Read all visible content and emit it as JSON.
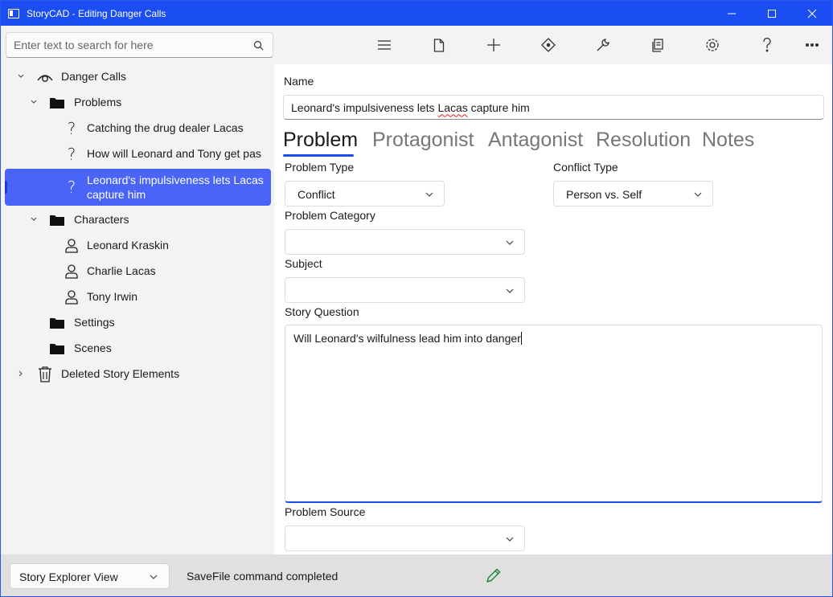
{
  "window": {
    "title": "StoryCAD - Editing Danger Calls",
    "accent": "#1a4ef2"
  },
  "search": {
    "placeholder": "Enter text to search for here"
  },
  "tree": {
    "root": "Danger Calls",
    "problems": "Problems",
    "problem_items": [
      "Catching the drug dealer Lacas",
      "How will Leonard and Tony get pas",
      "Leonard's impulsiveness lets Lacas capture him"
    ],
    "characters": "Characters",
    "character_items": [
      "Leonard Kraskin",
      "Charlie Lacas",
      "Tony Irwin"
    ],
    "settings": "Settings",
    "scenes": "Scenes",
    "deleted": "Deleted Story Elements",
    "selected_color": "#4a64f8"
  },
  "toolbar": {
    "icons": [
      "hamburger-menu-icon",
      "new-file-icon",
      "add-icon",
      "move-icon",
      "tools-icon",
      "reports-icon",
      "settings-icon",
      "help-icon",
      "more-icon"
    ]
  },
  "form": {
    "name_label": "Name",
    "name_value_pre": "Leonard's impulsiveness lets ",
    "name_value_misspelled": "Lacas",
    "name_value_post": " capture him",
    "tabs": [
      "Problem",
      "Protagonist",
      "Antagonist",
      "Resolution",
      "Notes"
    ],
    "active_tab": "Problem",
    "problem_type_label": "Problem Type",
    "problem_type_value": "Conflict",
    "conflict_type_label": "Conflict Type",
    "conflict_type_value": "Person vs. Self",
    "problem_category_label": "Problem Category",
    "problem_category_value": "",
    "subject_label": "Subject",
    "subject_value": "",
    "story_question_label": "Story Question",
    "story_question_value": "Will Leonard's wilfulness lead him into danger",
    "problem_source_label": "Problem Source",
    "problem_source_value": ""
  },
  "status": {
    "view_selector": "Story Explorer View",
    "message": "SaveFile command completed",
    "edit_icon_color": "#1e8a3c"
  }
}
